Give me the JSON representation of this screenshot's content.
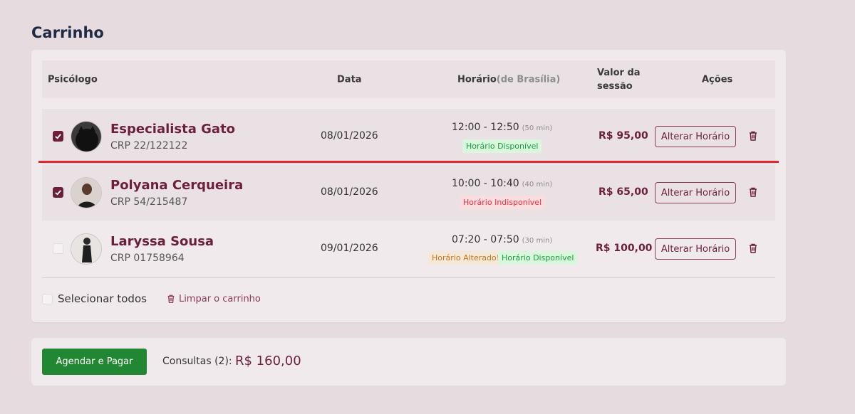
{
  "page": {
    "title": "Carrinho"
  },
  "table": {
    "headers": {
      "psicologo": "Psicólogo",
      "data": "Data",
      "horario": "Horário",
      "horario_sub": "(de Brasília)",
      "valor": "Valor da sessão",
      "acoes": "Ações"
    },
    "rows": [
      {
        "checked": true,
        "name": "Especialista Gato",
        "crp": "CRP 22/122122",
        "date": "08/01/2026",
        "time": "12:00 - 12:50",
        "duration": "(50 min)",
        "badges": [
          "Horário Disponível"
        ],
        "price": "R$ 95,00",
        "action": "Alterar Horário"
      },
      {
        "checked": true,
        "name": "Polyana Cerqueira",
        "crp": "CRP 54/215487",
        "date": "08/01/2026",
        "time": "10:00 - 10:40",
        "duration": "(40 min)",
        "badges": [
          "Horário Indisponível"
        ],
        "price": "R$ 65,00",
        "action": "Alterar Horário"
      },
      {
        "checked": false,
        "name": "Laryssa Sousa",
        "crp": "CRP 01758964",
        "date": "09/01/2026",
        "time": "07:20 - 07:50",
        "duration": "(30 min)",
        "badges": [
          "Horário Alterado!",
          "Horário Disponível"
        ],
        "price": "R$ 100,00",
        "action": "Alterar Horário"
      }
    ]
  },
  "cart_footer": {
    "select_all": "Selecionar todos",
    "clear_cart": "Limpar o carrinho"
  },
  "summary": {
    "pay_button": "Agendar e Pagar",
    "count_label": "Consultas (2):",
    "total": "R$ 160,00"
  },
  "colors": {
    "brand": "#6b1f3d",
    "pay": "#228733",
    "available": "#1e9b3e",
    "unavailable": "#e0323f",
    "changed": "#c07727"
  }
}
